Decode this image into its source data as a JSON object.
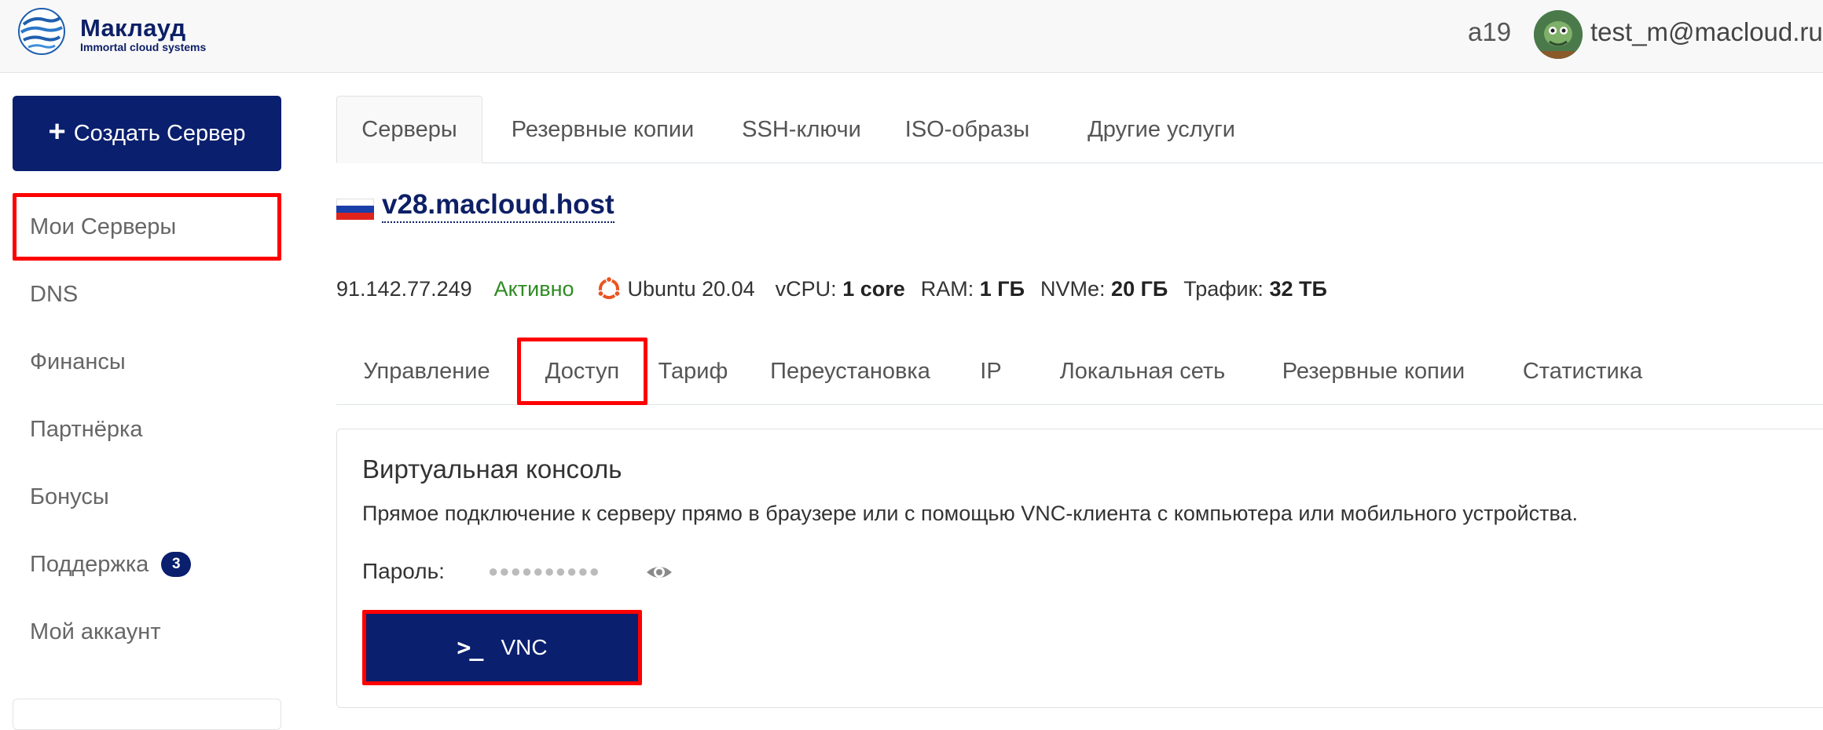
{
  "header": {
    "brand_name": "Маклауд",
    "brand_tagline": "Immortal cloud systems",
    "user_id": "a19",
    "user_email": "test_m@macloud.ru"
  },
  "sidebar": {
    "create_button": "Создать Сервер",
    "items": [
      {
        "label": "Мои Серверы",
        "active": true
      },
      {
        "label": "DNS"
      },
      {
        "label": "Финансы"
      },
      {
        "label": "Партнёрка"
      },
      {
        "label": "Бонусы"
      },
      {
        "label": "Поддержка",
        "badge": "3"
      },
      {
        "label": "Мой аккаунт"
      }
    ]
  },
  "main_tabs": [
    {
      "label": "Серверы",
      "active": true
    },
    {
      "label": "Резервные копии"
    },
    {
      "label": "SSH-ключи"
    },
    {
      "label": "ISO-образы"
    },
    {
      "label": "Другие услуги"
    }
  ],
  "server": {
    "flag": "russia-flag-icon",
    "name": "v28.macloud.host",
    "ip": "91.142.77.249",
    "status": "Активно",
    "os": "Ubuntu 20.04",
    "vcpu_label": "vCPU:",
    "vcpu_value": "1 core",
    "ram_label": "RAM:",
    "ram_value": "1 ГБ",
    "nvme_label": "NVMe:",
    "nvme_value": "20 ГБ",
    "traffic_label": "Трафик:",
    "traffic_value": "32 ТБ"
  },
  "sub_tabs": [
    {
      "label": "Управление"
    },
    {
      "label": "Доступ",
      "active": true
    },
    {
      "label": "Тариф"
    },
    {
      "label": "Переустановка"
    },
    {
      "label": "IP"
    },
    {
      "label": "Локальная сеть"
    },
    {
      "label": "Резервные копии"
    },
    {
      "label": "Статистика"
    }
  ],
  "console": {
    "title": "Виртуальная консоль",
    "description": "Прямое подключение к серверу прямо в браузере или с помощью VNC-клиента с компьютера или мобильного устройства.",
    "password_label": "Пароль:",
    "password_mask": "●●●●●●●●●●",
    "button_label": "VNC"
  },
  "colors": {
    "primary": "#0a1f6e",
    "highlight": "#ff0000",
    "status_active": "#2e8b22"
  }
}
